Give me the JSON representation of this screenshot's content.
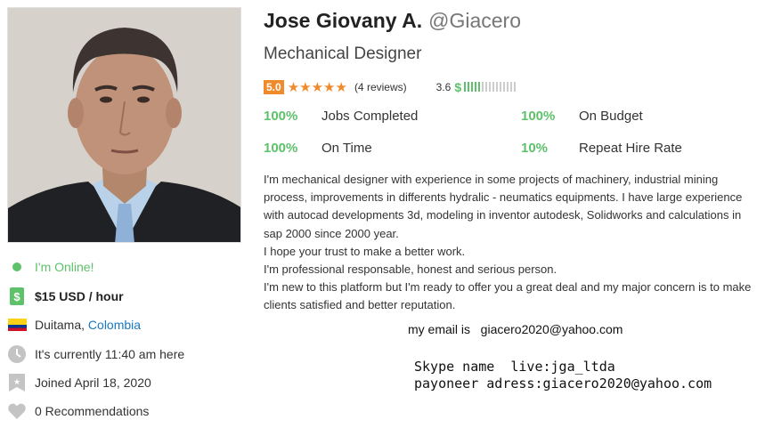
{
  "profile": {
    "name": "Jose Giovany A.",
    "handle": "@Giacero",
    "title": "Mechanical Designer"
  },
  "rating": {
    "score": "5.0",
    "stars": "★★★★★",
    "reviews": "(4 reviews)",
    "earnings_score": "3.6",
    "earnings_symbol": "$",
    "earnings_level": 0.3
  },
  "stats": [
    {
      "value": "100%",
      "label": "Jobs Completed"
    },
    {
      "value": "100%",
      "label": "On Budget"
    },
    {
      "value": "100%",
      "label": "On Time"
    },
    {
      "value": "10%",
      "label": "Repeat Hire Rate"
    }
  ],
  "bio": [
    "I'm mechanical designer with experience in some projects of machinery, industrial mining process, improvements in differents hydralic - neumatics equipments. I have large experience with autocad developments 3d, modeling in inventor autodesk, Solidworks and calculations in sap 2000 since 2000 year.",
    "I hope your trust to make a better work.",
    "I'm professional responsable, honest and serious person.",
    "I'm new to this platform but I'm ready to offer you a great deal and my major concern is to make clients satisfied and better reputation."
  ],
  "contact": {
    "email_line": "my email is   giacero2020@yahoo.com",
    "skype_line": "Skype name  live:jga_ltda",
    "payoneer_line": "payoneer adress:giacero2020@yahoo.com"
  },
  "sidebar": {
    "online": "I'm Online!",
    "rate": "$15 USD / hour",
    "city": "Duitama,",
    "country": "Colombia",
    "local_time": "It's currently 11:40 am here",
    "joined": "Joined April 18, 2020",
    "recommendations": "0 Recommendations"
  },
  "colors": {
    "accent_green": "#5dc26a",
    "rating_orange": "#f08a2b",
    "link_blue": "#1a78c2"
  },
  "icons": [
    "online-dot-icon",
    "money-icon",
    "colombia-flag-icon",
    "clock-icon",
    "calendar-badge-icon",
    "heart-icon"
  ]
}
